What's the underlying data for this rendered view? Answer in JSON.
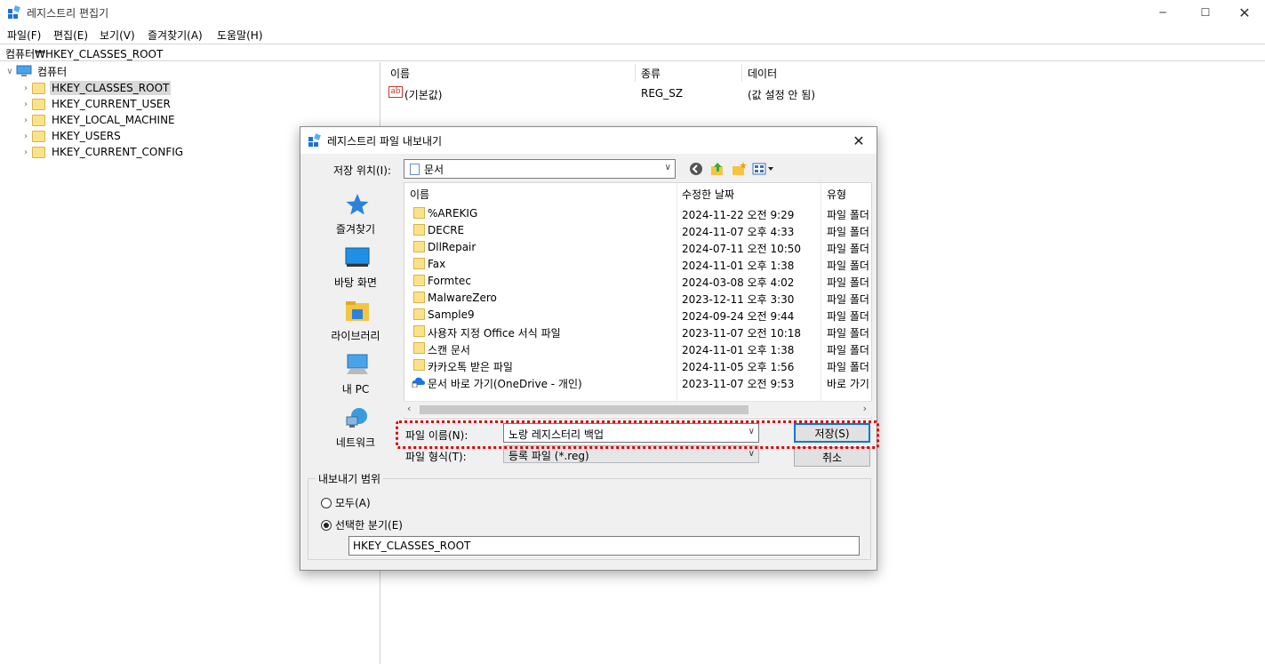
{
  "window": {
    "title": "레지스트리 편집기"
  },
  "menu": [
    "파일(F)",
    "편집(E)",
    "보기(V)",
    "즐겨찾기(A)",
    "도움말(H)"
  ],
  "address": "컴퓨터₩HKEY_CLASSES_ROOT",
  "tree": {
    "root": "컴퓨터",
    "items": [
      "HKEY_CLASSES_ROOT",
      "HKEY_CURRENT_USER",
      "HKEY_LOCAL_MACHINE",
      "HKEY_USERS",
      "HKEY_CURRENT_CONFIG"
    ]
  },
  "list": {
    "headers": {
      "name": "이름",
      "type": "종류",
      "data": "데이터"
    },
    "rows": [
      {
        "name": "(기본값)",
        "type": "REG_SZ",
        "data": "(값 설정 안 됨)"
      }
    ]
  },
  "dialog": {
    "title": "레지스트리 파일 내보내기",
    "location_label": "저장 위치(I):",
    "location_value": "문서",
    "places": [
      "즐겨찾기",
      "바탕 화면",
      "라이브러리",
      "내 PC",
      "네트워크"
    ],
    "file_headers": {
      "name": "이름",
      "date": "수정한 날짜",
      "type": "유형"
    },
    "files": [
      {
        "name": "%AREKIG",
        "date": "2024-11-22 오전 9:29",
        "type": "파일 폴더"
      },
      {
        "name": "DECRE",
        "date": "2024-11-07 오후 4:33",
        "type": "파일 폴더"
      },
      {
        "name": "DllRepair",
        "date": "2024-07-11 오전 10:50",
        "type": "파일 폴더"
      },
      {
        "name": "Fax",
        "date": "2024-11-01 오후 1:38",
        "type": "파일 폴더"
      },
      {
        "name": "Formtec",
        "date": "2024-03-08 오후 4:02",
        "type": "파일 폴더"
      },
      {
        "name": "MalwareZero",
        "date": "2023-12-11 오후 3:30",
        "type": "파일 폴더"
      },
      {
        "name": "Sample9",
        "date": "2024-09-24 오전 9:44",
        "type": "파일 폴더"
      },
      {
        "name": "사용자 지정 Office 서식 파일",
        "date": "2023-11-07 오전 10:18",
        "type": "파일 폴더"
      },
      {
        "name": "스캔 문서",
        "date": "2024-11-01 오후 1:38",
        "type": "파일 폴더"
      },
      {
        "name": "카카오톡 받은 파일",
        "date": "2024-11-05 오후 1:56",
        "type": "파일 폴더"
      },
      {
        "name": "문서 바로 가기(OneDrive - 개인)",
        "date": "2023-11-07 오전 9:53",
        "type": "바로 가기"
      }
    ],
    "filename_label": "파일 이름(N):",
    "filename_value": "노랑 레지스터리 백업",
    "filetype_label": "파일 형식(T):",
    "filetype_value": "등록 파일 (*.reg)",
    "save_label": "저장(S)",
    "cancel_label": "취소",
    "range_label": "내보내기 범위",
    "range_all": "모두(A)",
    "range_selected": "선택한 분기(E)",
    "branch_value": "HKEY_CLASSES_ROOT"
  },
  "colors": {
    "highlight": "#e00000",
    "accent": "#0078d7",
    "folder": "#fbe28a"
  }
}
